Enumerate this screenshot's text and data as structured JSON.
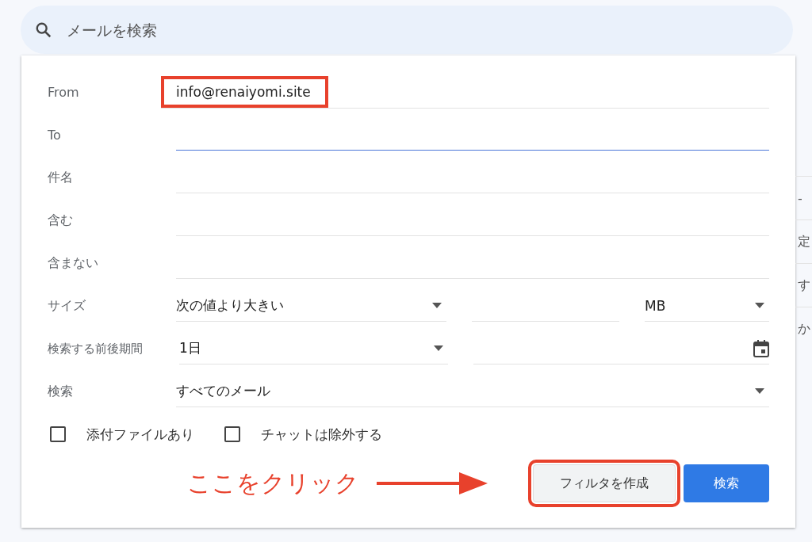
{
  "search": {
    "placeholder": "メールを検索"
  },
  "rows": [
    {
      "kind": "text",
      "label": "From",
      "value": "info@renaiyomi.site",
      "highlighted": true,
      "focused": false
    },
    {
      "kind": "text",
      "label": "To",
      "highlighted": false,
      "focused": true
    },
    {
      "kind": "text",
      "label": "件名",
      "highlighted": false,
      "focused": false
    },
    {
      "kind": "text",
      "label": "含む",
      "highlighted": false,
      "focused": false
    },
    {
      "kind": "text",
      "label": "含まない",
      "highlighted": false,
      "focused": false
    },
    {
      "kind": "size",
      "label": "サイズ",
      "operator": "次の値より大きい",
      "unit": "MB"
    },
    {
      "kind": "date",
      "label": "検索する前後期間",
      "value": "1日"
    },
    {
      "kind": "select",
      "label": "検索",
      "value": "すべてのメール"
    }
  ],
  "checkboxes": [
    {
      "label": "添付ファイルあり",
      "checked": false
    },
    {
      "label": "チャットは除外する",
      "checked": false
    }
  ],
  "annotation": {
    "text": "ここをクリック"
  },
  "buttons": [
    {
      "label": "フィルタを作成",
      "kind": "secondary",
      "highlighted": true
    },
    {
      "label": "検索",
      "kind": "primary",
      "highlighted": false
    }
  ],
  "background_list": [
    "-",
    "定",
    "す",
    "か"
  ]
}
